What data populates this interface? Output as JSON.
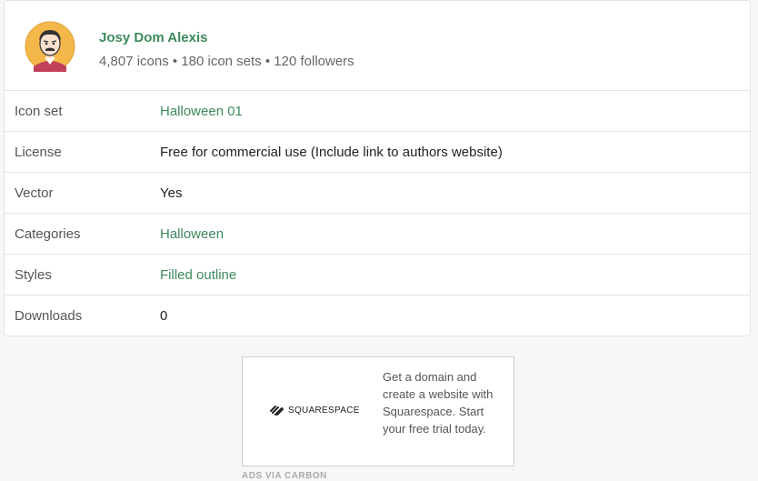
{
  "author": {
    "name": "Josy Dom Alexis",
    "stats": "4,807 icons • 180 icon sets • 120 followers"
  },
  "details": [
    {
      "label": "Icon set",
      "value": "Halloween 01",
      "link": true
    },
    {
      "label": "License",
      "value": "Free for commercial use (Include link to authors website)",
      "link": false
    },
    {
      "label": "Vector",
      "value": "Yes",
      "link": false
    },
    {
      "label": "Categories",
      "value": "Halloween",
      "link": true
    },
    {
      "label": "Styles",
      "value": "Filled outline",
      "link": true
    },
    {
      "label": "Downloads",
      "value": "0",
      "link": false
    }
  ],
  "ad": {
    "brand": "SQUARESPACE",
    "text": "Get a domain and create a website with Squarespace. Start your free trial today.",
    "via": "ADS VIA CARBON"
  },
  "colors": {
    "link": "#3c8a5c",
    "avatar_bg": "#f4b84a"
  }
}
